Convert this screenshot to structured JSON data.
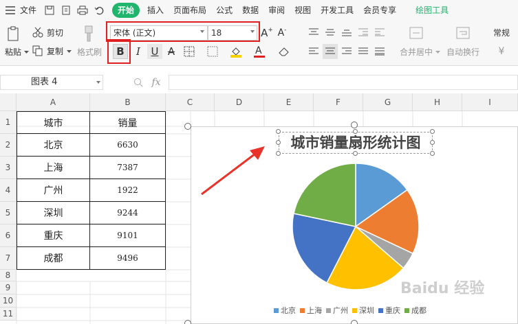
{
  "menu": {
    "file": "文件",
    "tabs": [
      "开始",
      "插入",
      "页面布局",
      "公式",
      "数据",
      "审阅",
      "视图",
      "开发工具",
      "会员专享"
    ],
    "context_tab": "绘图工具"
  },
  "ribbon": {
    "paste": "粘贴",
    "cut": "剪切",
    "copy": "复制",
    "format_painter": "格式刷",
    "font_name": "宋体 (正文)",
    "font_size": "18",
    "merge_center": "合并居中",
    "wrap_text": "自动换行",
    "number_format": "常规"
  },
  "formula_bar": {
    "name_box": "图表 4",
    "fx": "fx"
  },
  "grid": {
    "columns": [
      "A",
      "B",
      "C",
      "D",
      "E",
      "F",
      "G",
      "H",
      "I"
    ],
    "rows": [
      "1",
      "2",
      "3",
      "4",
      "5",
      "6",
      "7",
      "8",
      "9",
      "10",
      "11"
    ]
  },
  "table": {
    "header": [
      "城市",
      "销量"
    ],
    "rows": [
      [
        "北京",
        "6630"
      ],
      [
        "上海",
        "7387"
      ],
      [
        "广州",
        "1922"
      ],
      [
        "深圳",
        "9244"
      ],
      [
        "重庆",
        "9101"
      ],
      [
        "成都",
        "9496"
      ]
    ]
  },
  "chart_data": {
    "type": "pie",
    "title": "城市销量扇形统计图",
    "categories": [
      "北京",
      "上海",
      "广州",
      "深圳",
      "重庆",
      "成都"
    ],
    "values": [
      6630,
      7387,
      1922,
      9244,
      9101,
      9496
    ],
    "colors": [
      "#5b9bd5",
      "#ed7d31",
      "#a5a5a5",
      "#ffc000",
      "#4472c4",
      "#70ad47"
    ],
    "legend_position": "bottom"
  },
  "watermark": "Baidu 经验"
}
